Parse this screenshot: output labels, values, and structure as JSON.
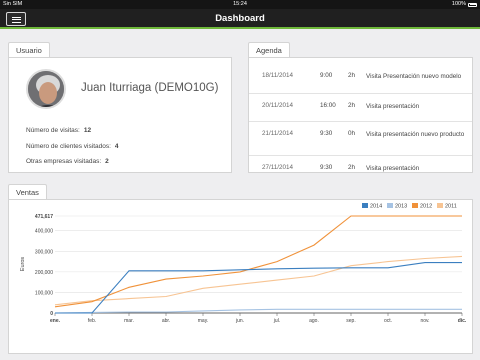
{
  "status_bar": {
    "carrier": "Sin SIM",
    "time": "15:24",
    "battery": "100%"
  },
  "navbar": {
    "title": "Dashboard"
  },
  "usuario": {
    "tab_label": "Usuario",
    "name": "Juan Iturriaga (DEMO10G)",
    "stats": [
      {
        "label": "Número de visitas:",
        "value": "12"
      },
      {
        "label": "Número de clientes visitados:",
        "value": "4"
      },
      {
        "label": "Otras empresas visitadas:",
        "value": "2"
      }
    ]
  },
  "agenda": {
    "tab_label": "Agenda",
    "items": [
      {
        "date": "18/11/2014",
        "time": "9:00",
        "duration": "2h",
        "description": "Visita Presentación nuevo modelo"
      },
      {
        "date": "20/11/2014",
        "time": "16:00",
        "duration": "2h",
        "description": "Visita presentación"
      },
      {
        "date": "21/11/2014",
        "time": "9:30",
        "duration": "0h",
        "description": "Visita presentación nuevo producto"
      },
      {
        "date": "27/11/2014",
        "time": "9:30",
        "duration": "2h",
        "description": "Visita presentación"
      }
    ]
  },
  "ventas": {
    "tab_label": "Ventas"
  },
  "chart_data": {
    "type": "line",
    "ylabel": "Euros",
    "xlabel": "",
    "categories": [
      "ene.",
      "feb.",
      "mar.",
      "abr.",
      "may.",
      "jun.",
      "jul.",
      "ago.",
      "sep.",
      "oct.",
      "nov.",
      "dic."
    ],
    "ylim": [
      0,
      471617
    ],
    "y_ticks": [
      "471,617",
      "400,000",
      "300,000",
      "200,000",
      "100,000",
      "0"
    ],
    "y_tick_values": [
      471617,
      400000,
      300000,
      200000,
      100000,
      0
    ],
    "grid": true,
    "legend_position": "top-right",
    "series": [
      {
        "name": "2014",
        "color": "#3b7fc0",
        "values": [
          0,
          0,
          205000,
          205000,
          205000,
          210000,
          215000,
          218000,
          220000,
          220000,
          245000,
          245000
        ]
      },
      {
        "name": "2013",
        "color": "#a6c3e3",
        "values": [
          0,
          3000,
          5000,
          5000,
          10000,
          15000,
          18000,
          18000,
          18000,
          18000,
          18000,
          18000
        ]
      },
      {
        "name": "2012",
        "color": "#f0923a",
        "values": [
          30000,
          55000,
          125000,
          165000,
          180000,
          200000,
          250000,
          330000,
          471617,
          471617,
          471617,
          471617
        ]
      },
      {
        "name": "2011",
        "color": "#f7c493",
        "values": [
          40000,
          60000,
          70000,
          80000,
          120000,
          140000,
          160000,
          180000,
          230000,
          250000,
          265000,
          275000
        ]
      }
    ]
  }
}
